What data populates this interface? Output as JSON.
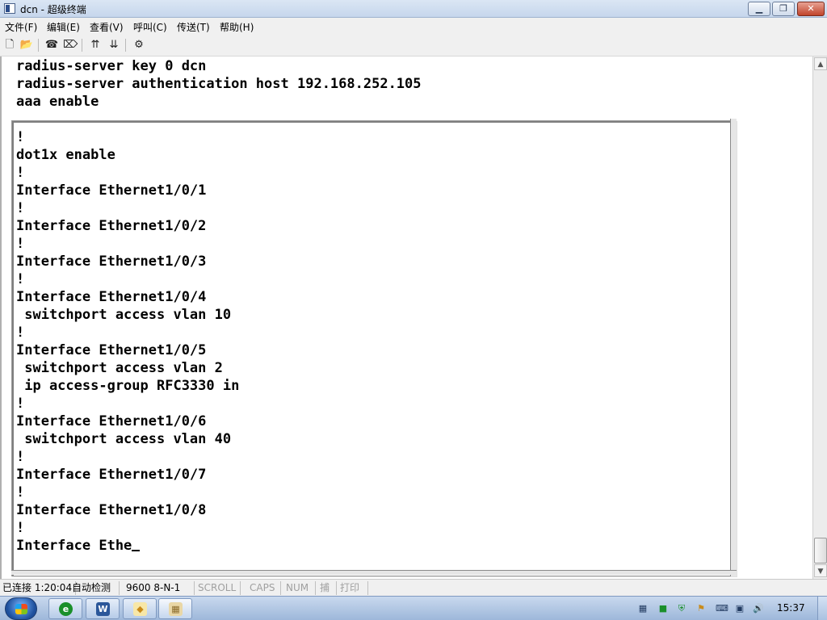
{
  "window": {
    "title": "dcn - 超级终端",
    "minimize_glyph": "▁",
    "maximize_glyph": "❐",
    "close_glyph": "✕"
  },
  "menu": {
    "items": [
      "文件(F)",
      "编辑(E)",
      "查看(V)",
      "呼叫(C)",
      "传送(T)",
      "帮助(H)"
    ]
  },
  "toolbar": {
    "icons": {
      "new": "🗋",
      "open": "📂",
      "connect": "☎",
      "disconnect": "⌦",
      "send": "⇈",
      "receive": "⇊",
      "properties": "⚙"
    }
  },
  "terminal": {
    "top_lines": [
      "radius-server key 0 dcn",
      "radius-server authentication host 192.168.252.105",
      "aaa enable"
    ],
    "lines": [
      "!",
      "dot1x enable",
      "!",
      "Interface Ethernet1/0/1",
      "!",
      "Interface Ethernet1/0/2",
      "!",
      "Interface Ethernet1/0/3",
      "!",
      "Interface Ethernet1/0/4",
      " switchport access vlan 10",
      "!",
      "Interface Ethernet1/0/5",
      " switchport access vlan 2",
      " ip access-group RFC3330 in",
      "!",
      "Interface Ethernet1/0/6",
      " switchport access vlan 40",
      "!",
      "Interface Ethernet1/0/7",
      "!",
      "Interface Ethernet1/0/8",
      "!"
    ],
    "current_line": "Interface Ethe"
  },
  "statusbar": {
    "connected": "已连接 1:20:04",
    "detect": "自动检测",
    "baud": "9600 8-N-1",
    "scroll": "SCROLL",
    "caps": "CAPS",
    "num": "NUM",
    "capture": "捕",
    "print": "打印"
  },
  "taskbar": {
    "clock": "15:37",
    "apps": [
      {
        "name": "ie",
        "glyph": "e",
        "color": "#1a8f2a"
      },
      {
        "name": "word",
        "glyph": "W",
        "color": "#2b579a"
      },
      {
        "name": "explorer",
        "glyph": "◆",
        "color": "#c98b1a"
      },
      {
        "name": "hyperterminal",
        "glyph": "▦",
        "color": "#8a6a2a"
      }
    ]
  }
}
